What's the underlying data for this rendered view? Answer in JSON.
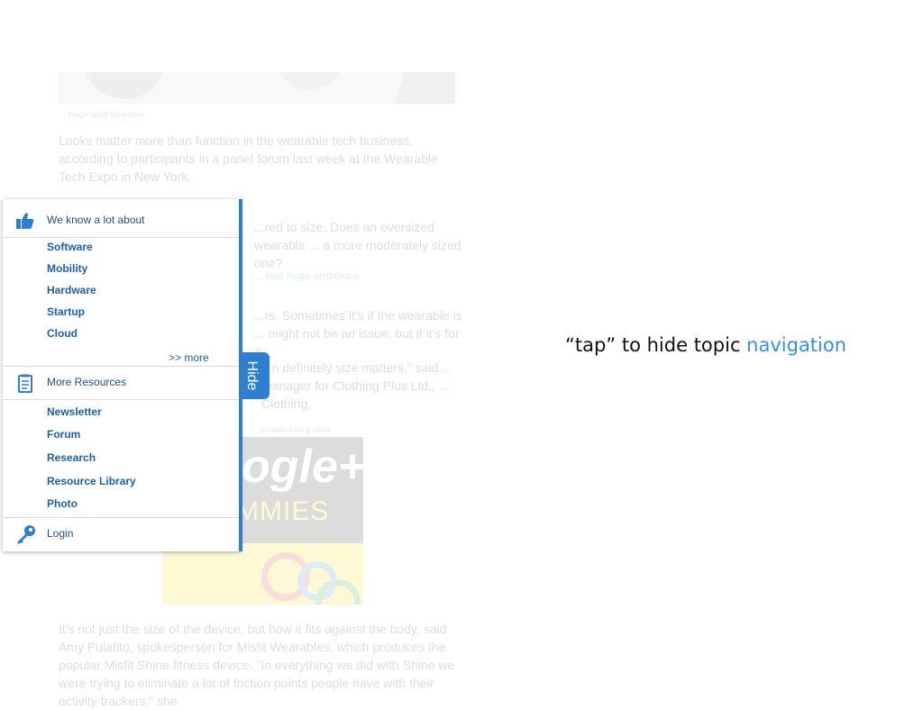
{
  "article": {
    "caption": "Image: Misfit Wearables",
    "para1": "Looks matter more than function in the wearable tech business, according to participants in a panel forum last week at the Wearable Tech Expo in New York.",
    "para2": "...red to size. Does an oversized wearable ... a more moderately sized one?",
    "link": "... has huge ambitions",
    "para3": "...rs. Sometimes it's if the wearable is ... might not be an issue, but if it's for a",
    "para4": "...n definitely size matters,\" said ... manager for Clothing Plus Ltd., ... Clothing.",
    "tiny": "...possible trading tablet",
    "book_title": "ogle+",
    "book_sub": "MMIES",
    "para5": "It's not just the size of the device, but how it fits against the body, said Amy Pulafito, spokesperson for Misfit Wearables, which produces the popular Misfit Shine fitness device. \"In everything we did with Shine we were trying to eliminate a lot of friction points people have with their activity trackers,\" she"
  },
  "nav": {
    "sections": [
      {
        "icon": "thumbs-up-icon",
        "title": "We know a lot about",
        "items": [
          "Software",
          "Mobility",
          "Hardware",
          "Startup",
          "Cloud"
        ],
        "more": ">> more"
      },
      {
        "icon": "notepad-icon",
        "title": "More Resources",
        "items": [
          "Newsletter",
          "Forum",
          "Research",
          "Resource Library",
          "Photo"
        ]
      },
      {
        "icon": "key-icon",
        "title": "Login"
      }
    ],
    "hide_label": "Hide",
    "accent_color": "#2f7fd1"
  },
  "hint": {
    "prefix": "“tap” to hide topic ",
    "accent": "navigation",
    "accent_color": "#3a8dde"
  }
}
